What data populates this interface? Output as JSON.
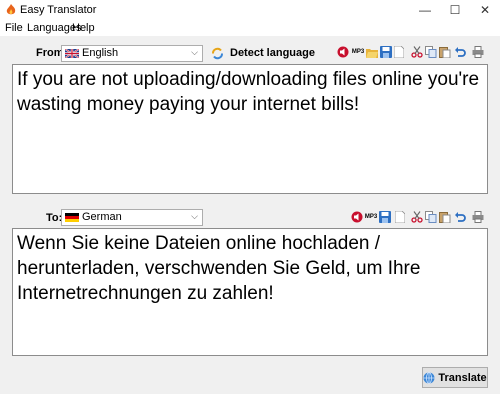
{
  "window": {
    "title": "Easy Translator",
    "minimize": "—",
    "maximize": "☐",
    "close": "✕"
  },
  "menu": {
    "file": "File",
    "languages": "Languages",
    "help": "Help"
  },
  "source": {
    "from_label": "From:",
    "language": "English",
    "detect_label": "Detect language",
    "text": "If you are not uploading/downloading files online you're wasting money paying your internet bills!"
  },
  "target": {
    "to_label": "To:",
    "language": "German",
    "text": " Wenn Sie keine Dateien online hochladen / herunterladen, verschwenden Sie Geld, um Ihre Internetrechnungen zu zahlen!"
  },
  "toolbar": {
    "mp3_label": "MP3"
  },
  "translate_button": "Translate",
  "icons": [
    "speaker-icon",
    "mp3-icon",
    "open-folder-icon",
    "save-icon",
    "new-document-icon",
    "cut-icon",
    "copy-icon",
    "paste-icon",
    "undo-icon",
    "print-icon",
    "refresh-icon",
    "globe-icon",
    "app-flame-icon"
  ]
}
